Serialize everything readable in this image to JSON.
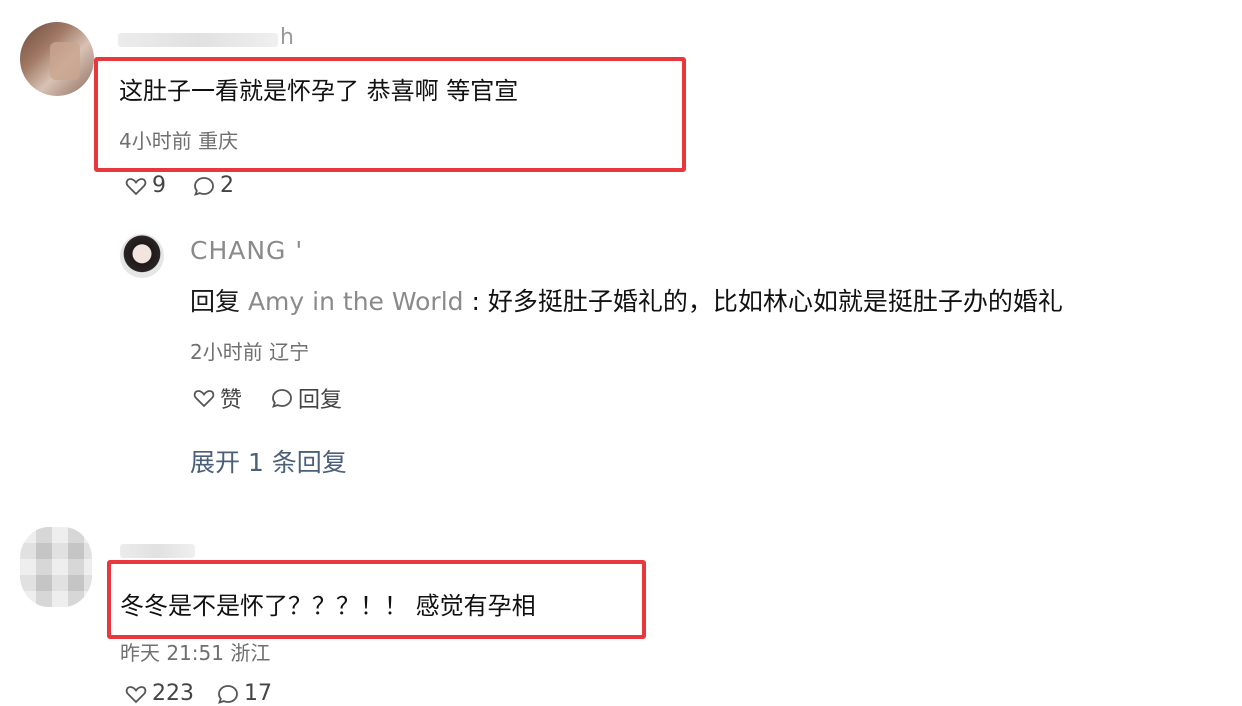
{
  "comment1": {
    "username_visible_suffix": "h",
    "text": "这肚子一看就是怀孕了 恭喜啊 等官宣",
    "meta": "4小时前 重庆",
    "likes": "9",
    "replies": "2"
  },
  "reply": {
    "username": "CHANG '",
    "prefix": "回复 ",
    "reply_to": "Amy in the World",
    "separator": " : ",
    "text": "好多挺肚子婚礼的，比如林心如就是挺肚子办的婚礼",
    "meta": "2小时前 辽宁",
    "like_label": "赞",
    "reply_label": "回复",
    "expand_label": "展开 1 条回复"
  },
  "comment3": {
    "text": "冬冬是不是怀了？？？！！ 感觉有孕相",
    "meta": "昨天 21:51 浙江",
    "likes": "223",
    "replies": "17"
  },
  "highlight_color": "#e8383d",
  "icons": {
    "like": "heart-outline-icon",
    "reply": "speech-bubble-icon"
  }
}
